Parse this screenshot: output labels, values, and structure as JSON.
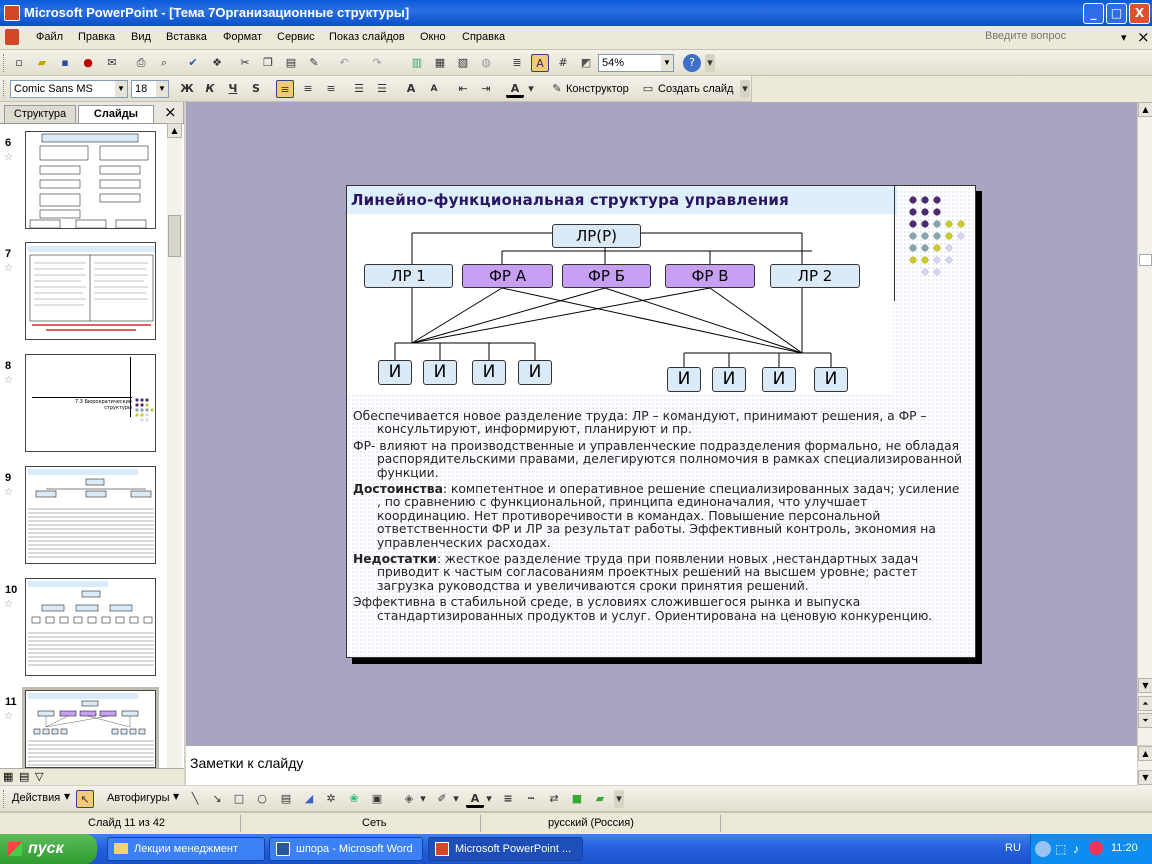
{
  "window": {
    "title": "Microsoft PowerPoint - [Тема 7Организационные структуры]",
    "controls": [
      "_",
      "□",
      "X"
    ]
  },
  "menu": {
    "items": [
      "Файл",
      "Правка",
      "Вид",
      "Вставка",
      "Формат",
      "Сервис",
      "Показ слайдов",
      "Окно",
      "Справка"
    ],
    "ask_placeholder": "Введите вопрос",
    "close": "×"
  },
  "toolbar": {
    "zoom": "54%",
    "font": "Comic Sans MS",
    "size": "18",
    "bold": "Ж",
    "italic": "К",
    "underline": "Ч",
    "shadow": "S",
    "designer": "Конструктор",
    "new_slide": "Создать слайд"
  },
  "panel": {
    "tabs": [
      "Структура",
      "Слайды"
    ],
    "close": "×",
    "slides": [
      {
        "num": "6"
      },
      {
        "num": "7"
      },
      {
        "num": "8",
        "label": "7.3 Бюрократические структуры"
      },
      {
        "num": "9"
      },
      {
        "num": "10"
      },
      {
        "num": "11"
      }
    ]
  },
  "slide": {
    "title": "Линейно-функциональная структура управления",
    "top_box": "ЛР(Р)",
    "boxes": [
      "ЛР 1",
      "ФР А",
      "ФР Б",
      "ФР В",
      "ЛР 2"
    ],
    "executor": "И",
    "p1": "Обеспечивается новое разделение труда: ЛР – командуют, принимают решения, а ФР – консультируют, информируют, планируют и пр.",
    "p2": "ФР- влияют на производственные и управленческие подразделения формально, не обладая распорядительскими правами, делегируются полномочия в рамках специализированной функции.",
    "p3_label": "Достоинства",
    "p3": ": компетентное и оперативное решение специализированных задач; усиление , по сравнению с функциональной, принципа единоначалия, что улучшает координацию. Нет противоречивости в командах. Повышение персональной ответственности ФР и ЛР за результат работы. Эффективный контроль, экономия на управленческих расходах.",
    "p4_label": "Недостатки",
    "p4": ": жесткое разделение труда при появлении новых ,нестандартных задач приводит к частым согласованиям проектных решений на высшем уровне; растет загрузка руководства и увеличиваются сроки принятия решений.",
    "p5": "Эффективна в стабильной среде, в условиях сложившегося рынка и выпуска стандартизированных продуктов и услуг. Ориентирована на ценовую конкуренцию.",
    "colors": {
      "title_bg": "#dceffa",
      "light_box": "#dbeaf7",
      "purple_box": "#c7a0f4",
      "dot_purple": "#4b2c6d",
      "dot_gray": "#8aa3ad",
      "dot_yellow": "#c9c92e",
      "dot_lavender": "#d7d4f0"
    }
  },
  "notes": {
    "placeholder": "Заметки к слайду"
  },
  "drawbar": {
    "actions": "Действия",
    "autoshapes": "Автофигуры"
  },
  "status": {
    "slide": "Слайд 11 из 42",
    "design": "Сеть",
    "language": "русский (Россия)"
  },
  "taskbar": {
    "start": "пуск",
    "tasks": [
      "Лекции менеджмент",
      "шпора - Microsoft Word",
      "Microsoft PowerPoint ..."
    ],
    "lang": "RU",
    "time": "11:20"
  }
}
